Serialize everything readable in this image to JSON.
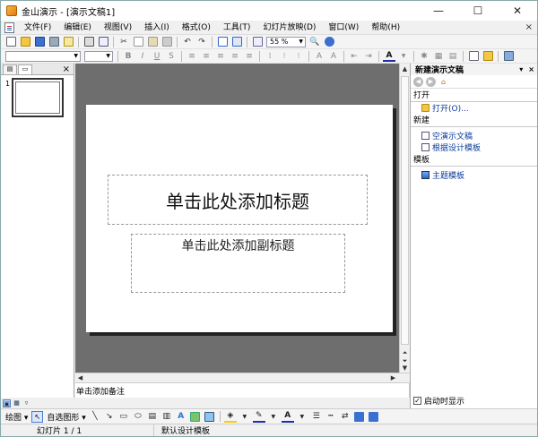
{
  "window": {
    "title": "金山演示 - [演示文稿1]",
    "minimize": "—",
    "maximize": "☐",
    "close": "✕"
  },
  "menu": {
    "items": [
      "文件(F)",
      "编辑(E)",
      "视图(V)",
      "插入(I)",
      "格式(O)",
      "工具(T)",
      "幻灯片放映(D)",
      "窗口(W)",
      "帮助(H)"
    ],
    "right_close": "×"
  },
  "toolbar": {
    "zoom_value": "55 %"
  },
  "left_panel": {
    "close": "×",
    "slide_number": "1"
  },
  "slide": {
    "title_placeholder": "单击此处添加标题",
    "subtitle_placeholder": "单击此处添加副标题"
  },
  "notes": {
    "placeholder": "单击添加备注"
  },
  "task_pane": {
    "title": "新建演示文稿",
    "close": "×",
    "sections": {
      "open": "打开",
      "new": "新建",
      "template": "模板"
    },
    "links": {
      "open": "打开(O)...",
      "blank": "空演示文稿",
      "from_design": "根据设计模板",
      "theme": "主题模板"
    },
    "startup_checkbox": "启动时显示",
    "startup_checked": true
  },
  "draw_toolbar": {
    "draw_label": "绘图 ▾",
    "autoshape_label": "自选图形 ▾"
  },
  "status": {
    "slide_info": "幻灯片 1 / 1",
    "design": "默认设计模板"
  },
  "colors": {
    "accent": "#0b3b9c",
    "workspace": "#6e6e6e"
  }
}
